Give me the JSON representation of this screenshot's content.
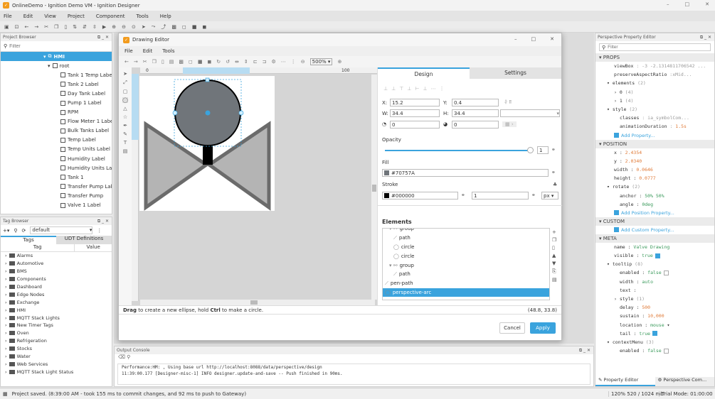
{
  "window": {
    "title": "OnlineDemo - Ignition Demo VM - Ignition Designer"
  },
  "menu": [
    "File",
    "Edit",
    "View",
    "Project",
    "Component",
    "Tools",
    "Help"
  ],
  "project_browser": {
    "title": "Project Browser",
    "filter_placeholder": "Filter",
    "root": "HMI",
    "child": "root",
    "items": [
      "Tank 1 Temp Label",
      "Tank 2 Label",
      "Day Tank Label",
      "Pump 1 Label",
      "RPM",
      "Flow Meter 1 Label",
      "Bulk Tanks Label",
      "Temp Label",
      "Temp Units Label",
      "Humidity Label",
      "Humidity Units Label",
      "Tank 1",
      "Transfer Pump Label",
      "Transfer Pump",
      "Valve 1 Label"
    ]
  },
  "tag_browser": {
    "title": "Tag Browser",
    "provider": "default",
    "tabs": [
      "Tags",
      "UDT Definitions"
    ],
    "columns": [
      "Tag",
      "Value"
    ],
    "items": [
      "Alarms",
      "Automotive",
      "BMS",
      "Components",
      "Dashboard",
      "Edge Nodes",
      "Exchange",
      "HMI",
      "MQTT Stack Lights",
      "New Timer Tags",
      "Oven",
      "Refrigeration",
      "Stocks",
      "Water",
      "Web Services",
      "MQTT Stack Light Status"
    ]
  },
  "drawing_editor": {
    "title": "Drawing Editor",
    "menu": [
      "File",
      "Edit",
      "Tools"
    ],
    "zoom": "500%",
    "ruler": [
      "0",
      "100"
    ],
    "tabs": [
      "Design",
      "Settings"
    ],
    "fields": {
      "x_label": "X:",
      "x": "15.2",
      "y_label": "Y:",
      "y": "0.4",
      "w_label": "W:",
      "w": "34.4",
      "h_label": "H:",
      "h": "34.4",
      "rx": "0",
      "ry": "0"
    },
    "opacity_label": "Opacity",
    "opacity": 1,
    "opacity_value": "1",
    "fill_label": "Fill",
    "fill": "#70757A",
    "stroke_label": "Stroke",
    "stroke": "#000000",
    "stroke_width": "1",
    "stroke_unit": "px",
    "elements_title": "Elements",
    "elements": [
      "group",
      "path",
      "circle",
      "circle",
      "group",
      "path",
      "pen-path",
      "perspective-arc"
    ],
    "hint_bold1": "Drag",
    "hint1": " to create a new ellipse, hold ",
    "hint_bold2": "Ctrl",
    "hint2": " to make a circle.",
    "coords": "(48.8, 33.8)",
    "cancel": "Cancel",
    "apply": "Apply"
  },
  "output_console": {
    "title": "Output Console",
    "lines": [
      "Performance:HM: , Using base url http://localhost:8088/data/perspective/design",
      "11:39:00.177 [Designer-misc-1] INFO designer.update-and-save -- Push finished in 90ms."
    ]
  },
  "property_editor": {
    "title": "Perspective Property Editor",
    "filter_placeholder": "Filter",
    "sections": {
      "props": "PROPS",
      "position": "POSITION",
      "custom": "CUSTOM",
      "meta": "META"
    },
    "props": {
      "viewBox": "-3 -2.1314811706542 ...",
      "preserveAspectRatio": "xMid...",
      "elements": "(2)",
      "e0": "(4)",
      "e1": "(4)",
      "style": "(2)",
      "classes": "ia_symbolCom...",
      "animationDuration": "1.5s",
      "add": "Add Property..."
    },
    "position": {
      "x": "2.4354",
      "y": "2.0340",
      "width": "0.0646",
      "height": "0.0777",
      "rotate": "(2)",
      "anchor": "50% 50%",
      "angle": "0deg",
      "add": "Add Position Property..."
    },
    "custom": {
      "add": "Add Custom Property..."
    },
    "meta": {
      "name": "Valve Drawing",
      "visible": "true",
      "tooltip": "(8)",
      "enabled": "false",
      "width": "auto",
      "text": "",
      "style": "(1)",
      "delay": "500",
      "sustain": "10,000",
      "location": "mouse",
      "tail": "true",
      "contextMenu": "(3)",
      "cm_enabled": "false"
    },
    "tabs": [
      "Property Editor",
      "Perspective Com..."
    ]
  },
  "status": {
    "message": "Project saved. (8:39:00 AM - took 155 ms to commit changes, and 92 ms to push to Gateway)",
    "memory": "120%  520 / 1024 mb",
    "trial": "Trial Mode: 01:00:00"
  },
  "colors": {
    "accent": "#3aa3dd",
    "selection": "#3aa3dd",
    "logo": "#f29b1d",
    "valve_fill": "#b4b4b4",
    "valve_stroke": "#6b6b6b",
    "circle_fill": "#70757A"
  }
}
